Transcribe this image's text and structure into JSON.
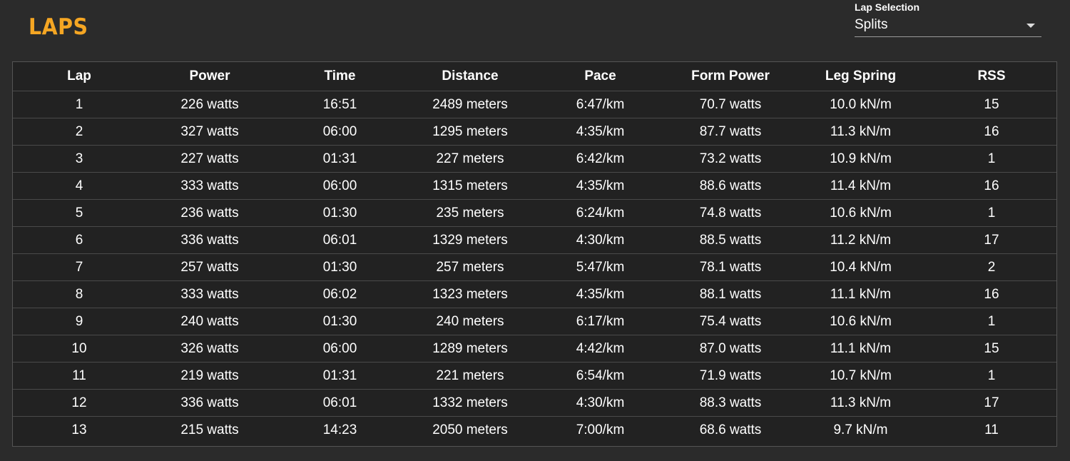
{
  "header": {
    "title": "LAPS"
  },
  "lap_selection": {
    "label": "Lap Selection",
    "value": "Splits"
  },
  "table": {
    "columns": [
      "Lap",
      "Power",
      "Time",
      "Distance",
      "Pace",
      "Form Power",
      "Leg Spring",
      "RSS"
    ],
    "rows": [
      [
        "1",
        "226 watts",
        "16:51",
        "2489 meters",
        "6:47/km",
        "70.7 watts",
        "10.0 kN/m",
        "15"
      ],
      [
        "2",
        "327 watts",
        "06:00",
        "1295 meters",
        "4:35/km",
        "87.7 watts",
        "11.3 kN/m",
        "16"
      ],
      [
        "3",
        "227 watts",
        "01:31",
        "227 meters",
        "6:42/km",
        "73.2 watts",
        "10.9 kN/m",
        "1"
      ],
      [
        "4",
        "333 watts",
        "06:00",
        "1315 meters",
        "4:35/km",
        "88.6 watts",
        "11.4 kN/m",
        "16"
      ],
      [
        "5",
        "236 watts",
        "01:30",
        "235 meters",
        "6:24/km",
        "74.8 watts",
        "10.6 kN/m",
        "1"
      ],
      [
        "6",
        "336 watts",
        "06:01",
        "1329 meters",
        "4:30/km",
        "88.5 watts",
        "11.2 kN/m",
        "17"
      ],
      [
        "7",
        "257 watts",
        "01:30",
        "257 meters",
        "5:47/km",
        "78.1 watts",
        "10.4 kN/m",
        "2"
      ],
      [
        "8",
        "333 watts",
        "06:02",
        "1323 meters",
        "4:35/km",
        "88.1 watts",
        "11.1 kN/m",
        "16"
      ],
      [
        "9",
        "240 watts",
        "01:30",
        "240 meters",
        "6:17/km",
        "75.4 watts",
        "10.6 kN/m",
        "1"
      ],
      [
        "10",
        "326 watts",
        "06:00",
        "1289 meters",
        "4:42/km",
        "87.0 watts",
        "11.1 kN/m",
        "15"
      ],
      [
        "11",
        "219 watts",
        "01:31",
        "221 meters",
        "6:54/km",
        "71.9 watts",
        "10.7 kN/m",
        "1"
      ],
      [
        "12",
        "336 watts",
        "06:01",
        "1332 meters",
        "4:30/km",
        "88.3 watts",
        "11.3 kN/m",
        "17"
      ],
      [
        "13",
        "215 watts",
        "14:23",
        "2050 meters",
        "7:00/km",
        "68.6 watts",
        "9.7 kN/m",
        "11"
      ]
    ]
  },
  "colors": {
    "background": "#2b2b2b",
    "table_background": "#222222",
    "accent": "#f5a623",
    "text": "#ffffff",
    "divider": "#4a4a4a"
  },
  "icons": {
    "dropdown": "chevron-down-icon"
  }
}
